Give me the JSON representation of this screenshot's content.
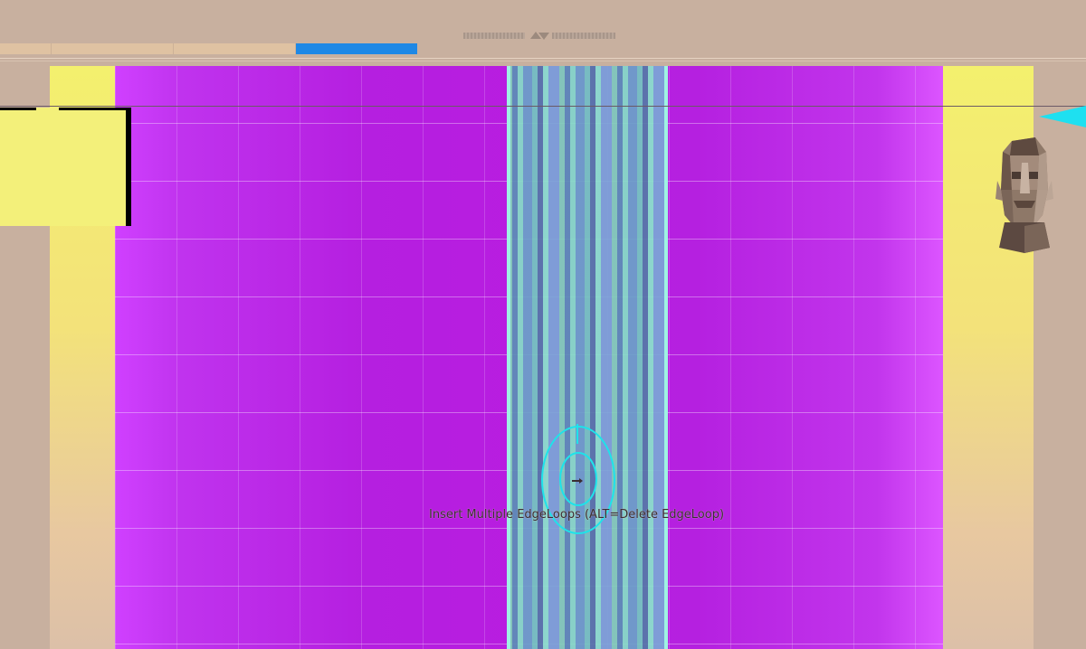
{
  "toolbar": {
    "tabs": [
      {
        "label": "",
        "active": false
      },
      {
        "label": "",
        "active": false
      },
      {
        "label": "",
        "active": false
      },
      {
        "label": "",
        "active": true
      }
    ]
  },
  "viewport": {
    "status_text": "Insert Multiple EdgeLoops (ALT=Delete EdgeLoop)"
  },
  "icons": {
    "gizmo": "transform-gizmo-icon",
    "head": "view-orientation-head-icon",
    "marker": "triangle-marker-icon",
    "collapse": "collapse-arrows-icon"
  },
  "colors": {
    "mesh": "#b81de0",
    "selection": "#7fd3b8",
    "gizmo": "#1ee3ea",
    "background_top": "#f3f06e",
    "active_tab": "#1e88e5"
  }
}
